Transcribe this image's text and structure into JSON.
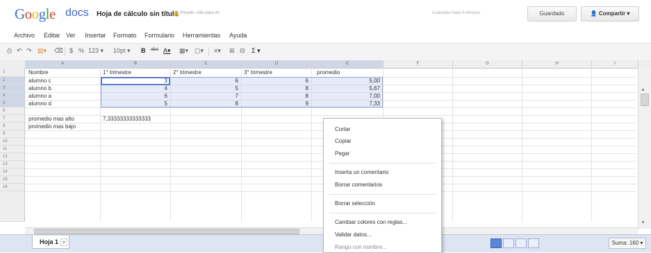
{
  "app": {
    "logo_google": "Google",
    "logo_docs": "docs",
    "doc_title": "Hoja de cálculo sin título",
    "private_label": "Privado, sólo para mí",
    "saved_status": "Guardado hace 0 minutos",
    "saved_button": "Guardado",
    "share_button": "Compartir"
  },
  "menubar": [
    "Archivo",
    "Editar",
    "Ver",
    "Insertar",
    "Formato",
    "Formulario",
    "Herramientas",
    "Ayuda"
  ],
  "toolbar": {
    "currency": "$",
    "percent": "%",
    "number_format": "123",
    "font_size": "10pt",
    "bold": "B",
    "strike": "abc",
    "text_color": "A",
    "sum": "Σ"
  },
  "columns": [
    "A",
    "B",
    "C",
    "D",
    "E",
    "F",
    "G",
    "H",
    "I"
  ],
  "rows": [
    "1",
    "2",
    "3",
    "4",
    "5",
    "6",
    "7",
    "8",
    "9",
    "10",
    "11",
    "12",
    "13",
    "14",
    "15",
    "16"
  ],
  "table": {
    "headers": [
      "Nombre",
      "1° trimestre",
      "2° trimestre",
      "3° trimestre",
      "promedio"
    ],
    "data": [
      {
        "name": "alumno c",
        "t1": "3",
        "t2": "6",
        "t3": "6",
        "avg": "5,00"
      },
      {
        "name": "alumno b",
        "t1": "4",
        "t2": "5",
        "t3": "8",
        "avg": "5,67"
      },
      {
        "name": "alumno a",
        "t1": "6",
        "t2": "7",
        "t3": "8",
        "avg": "7,00"
      },
      {
        "name": "alumno d",
        "t1": "5",
        "t2": "8",
        "t3": "9",
        "avg": "7,33"
      }
    ],
    "row7_label": "promedio mas alto",
    "row7_value": "7,33333333333333",
    "row8_label": "promedio mas bajo"
  },
  "context_menu": {
    "cut": "Cortar",
    "copy": "Copiar",
    "paste": "Pegar",
    "insert_comment": "Inserta un comentario",
    "delete_comments": "Borrar comentarios",
    "delete_selection": "Borrar selección",
    "change_colors": "Cambiar colores con reglas...",
    "validate": "Validar datos...",
    "more": "Rango con nombre..."
  },
  "bottom": {
    "sheet_tab": "Hoja 1",
    "sum_label": "Suma: 160"
  },
  "colors": {
    "accent": "#3a66c5",
    "selection": "#c6d2f0",
    "bottom_bar": "#dde4f2"
  }
}
